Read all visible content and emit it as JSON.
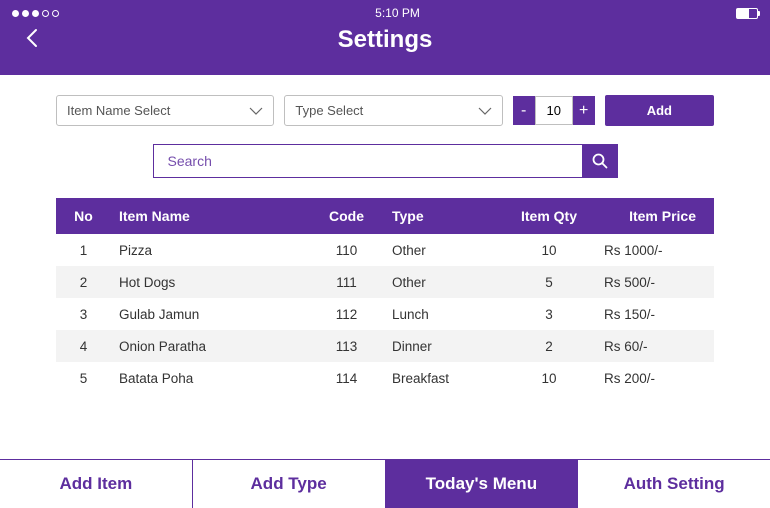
{
  "status": {
    "time": "5:10 PM"
  },
  "header": {
    "title": "Settings"
  },
  "controls": {
    "item_select_label": "Item Name Select",
    "type_select_label": "Type Select",
    "qty_value": "10",
    "add_label": "Add"
  },
  "search": {
    "placeholder": "Search"
  },
  "table": {
    "headers": {
      "no": "No",
      "name": "Item Name",
      "code": "Code",
      "type": "Type",
      "qty": "Item Qty",
      "price": "Item Price"
    },
    "rows": [
      {
        "no": "1",
        "name": "Pizza",
        "code": "110",
        "type": "Other",
        "qty": "10",
        "price": "Rs 1000/-"
      },
      {
        "no": "2",
        "name": "Hot Dogs",
        "code": "111",
        "type": "Other",
        "qty": "5",
        "price": "Rs 500/-"
      },
      {
        "no": "3",
        "name": "Gulab Jamun",
        "code": "112",
        "type": "Lunch",
        "qty": "3",
        "price": "Rs 150/-"
      },
      {
        "no": "4",
        "name": "Onion Paratha",
        "code": "113",
        "type": "Dinner",
        "qty": "2",
        "price": "Rs 60/-"
      },
      {
        "no": "5",
        "name": "Batata Poha",
        "code": "114",
        "type": "Breakfast",
        "qty": "10",
        "price": "Rs 200/-"
      }
    ]
  },
  "tabs": {
    "add_item": "Add Item",
    "add_type": "Add Type",
    "todays_menu": "Today's Menu",
    "auth_setting": "Auth Setting"
  },
  "colors": {
    "accent": "#5D2E9E"
  }
}
